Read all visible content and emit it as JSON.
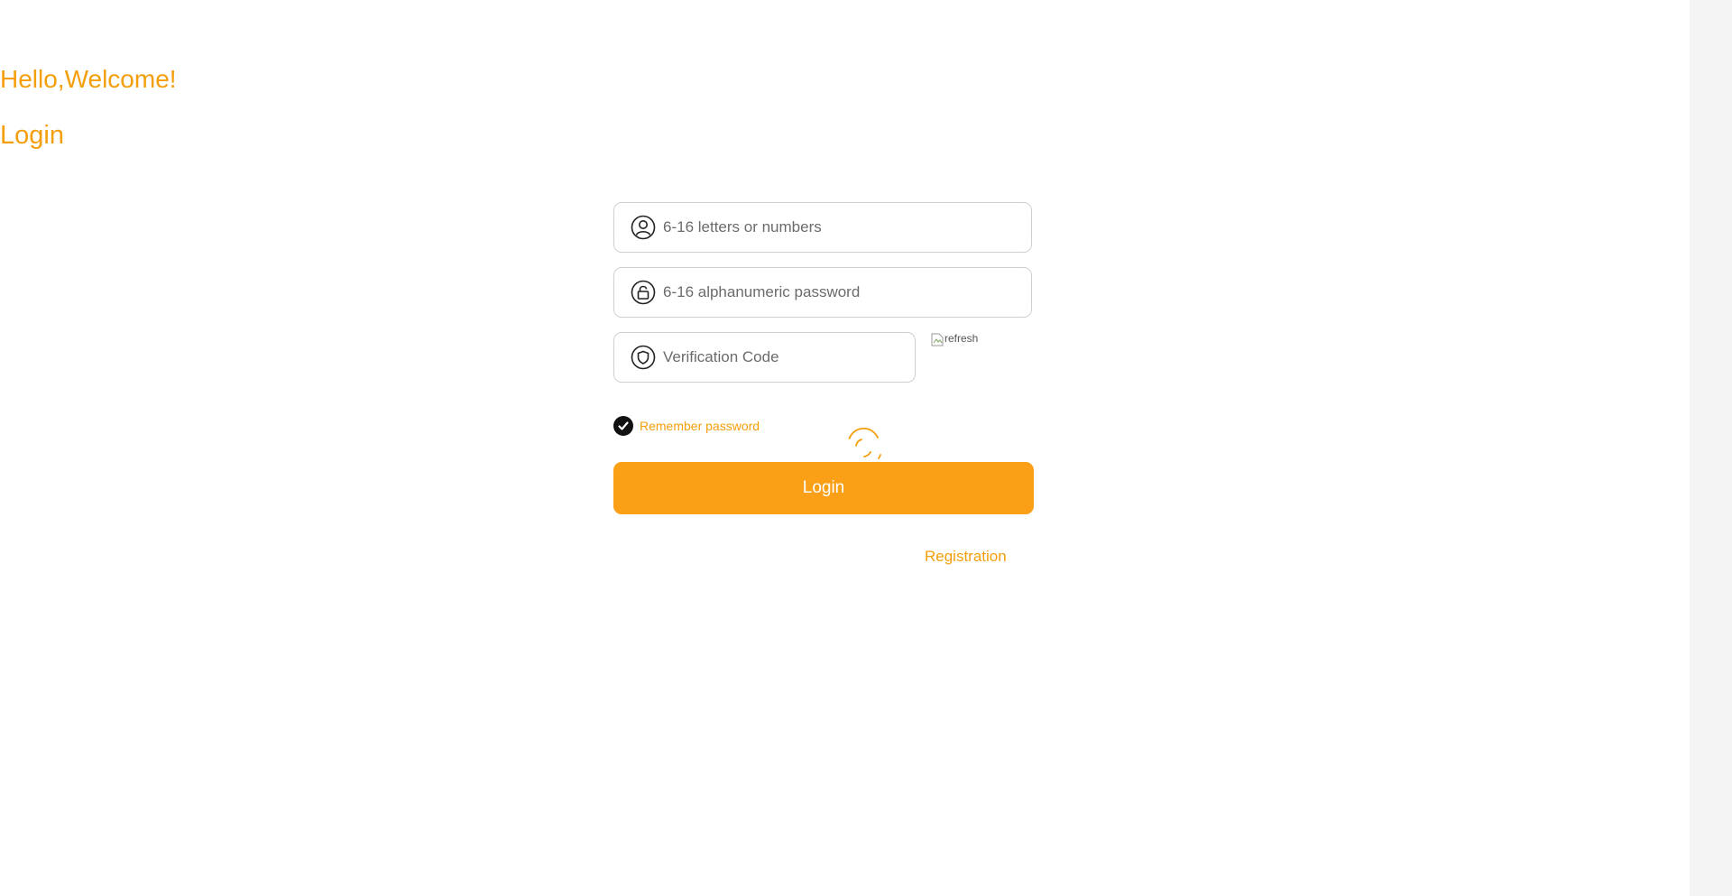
{
  "header": {
    "greeting": "Hello,Welcome!",
    "title": "Login"
  },
  "form": {
    "username": {
      "placeholder": "6-16 letters or numbers",
      "value": "",
      "icon": "user-icon"
    },
    "password": {
      "placeholder": "6-16 alphanumeric password",
      "value": "",
      "icon": "lock-icon"
    },
    "verification": {
      "placeholder": "Verification Code",
      "value": "",
      "icon": "shield-icon"
    },
    "captcha": {
      "alt": "refresh"
    },
    "remember": {
      "label": "Remember password",
      "checked": true
    },
    "login_label": "Login",
    "registration_label": "Registration"
  },
  "colors": {
    "accent": "#f59e0b",
    "button": "#fba016",
    "checkbox": "#111111"
  }
}
